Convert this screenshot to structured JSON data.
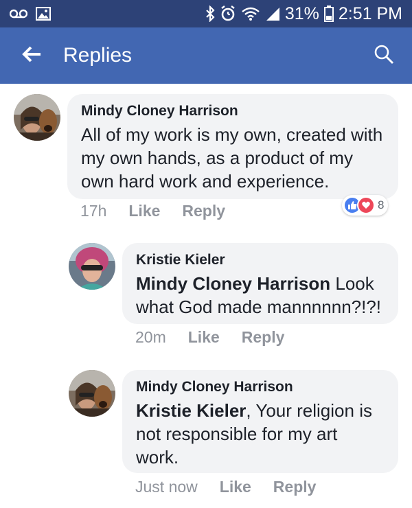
{
  "status_bar": {
    "battery": "31%",
    "time": "2:51 PM",
    "icons": [
      "voicemail-icon",
      "gallery-icon",
      "bluetooth-icon",
      "alarm-icon",
      "wifi-icon",
      "signal-icon",
      "battery-icon"
    ]
  },
  "app_bar": {
    "title": "Replies",
    "back_icon": "back-arrow-icon",
    "search_icon": "search-icon",
    "background": "#4267b2"
  },
  "comments": [
    {
      "author": "Mindy Cloney Harrison",
      "mention": "",
      "text": "All of my work is my own,  created with my own hands,  as a product of my own hard work and experience.",
      "time": "17h",
      "like_label": "Like",
      "reply_label": "Reply",
      "reaction_count": "8",
      "reactions": [
        "like-reaction-icon",
        "love-reaction-icon"
      ]
    },
    {
      "author": "Kristie Kieler",
      "mention": "Mindy Cloney Harrison",
      "text": " Look what God made mannnnnn?!?!",
      "time": "20m",
      "like_label": "Like",
      "reply_label": "Reply"
    },
    {
      "author": "Mindy Cloney Harrison",
      "mention": "Kristie Kieler",
      "text": ", Your religion is not responsible for my art work.",
      "time": "Just now",
      "like_label": "Like",
      "reply_label": "Reply"
    }
  ],
  "colors": {
    "status_bar": "#2d4277",
    "bubble": "#f2f3f5",
    "meta_text": "#90949c",
    "like_blue": "#4a7ff0",
    "love_red": "#ed4759"
  }
}
